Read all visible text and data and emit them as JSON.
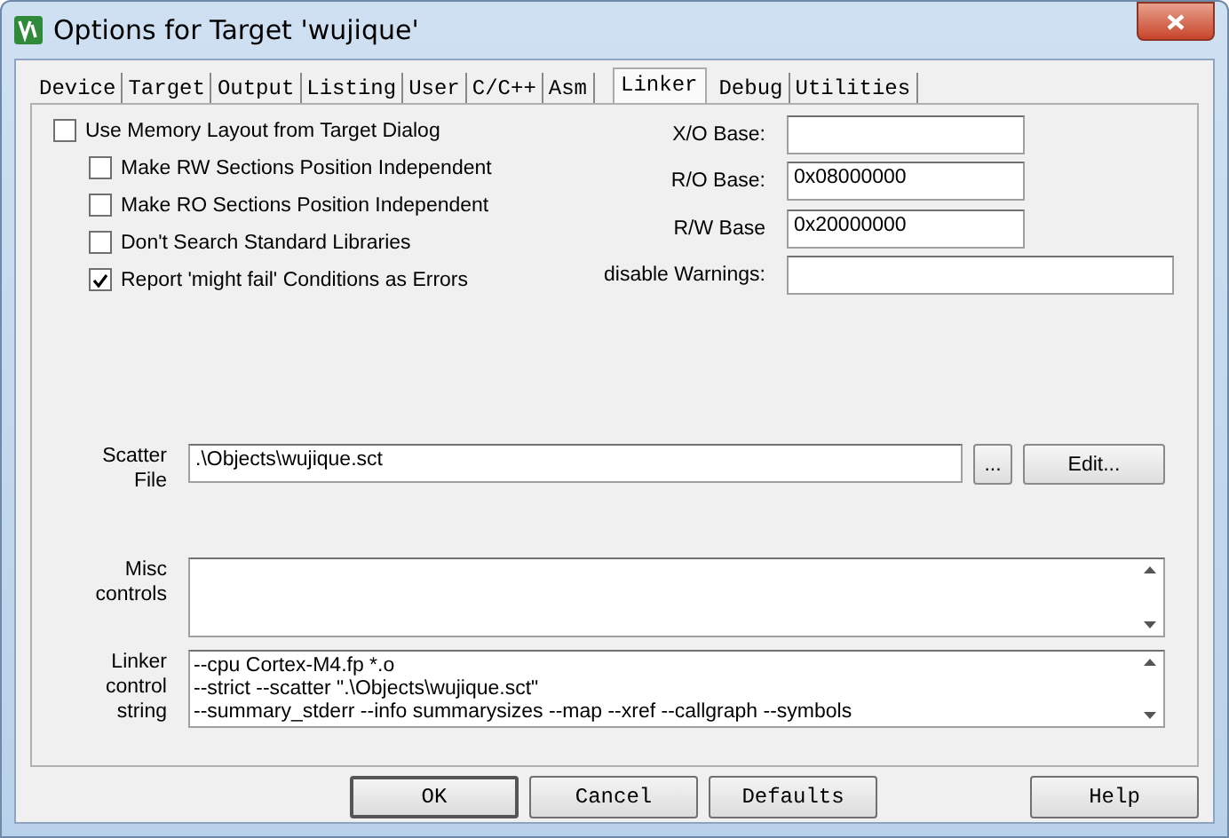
{
  "window": {
    "title": "Options for Target 'wujique'"
  },
  "tabs": [
    {
      "label": "Device",
      "selected": false
    },
    {
      "label": "Target",
      "selected": false
    },
    {
      "label": "Output",
      "selected": false
    },
    {
      "label": "Listing",
      "selected": false
    },
    {
      "label": "User",
      "selected": false
    },
    {
      "label": "C/C++",
      "selected": false
    },
    {
      "label": "Asm",
      "selected": false
    },
    {
      "label": "Linker",
      "selected": true
    },
    {
      "label": "Debug",
      "selected": false
    },
    {
      "label": "Utilities",
      "selected": false
    }
  ],
  "options": [
    {
      "kind": "main",
      "label": "Use Memory Layout from Target Dialog",
      "checked": false
    },
    {
      "kind": "sub",
      "label": "Make RW Sections Position Independent",
      "checked": false
    },
    {
      "kind": "sub",
      "label": "Make RO Sections Position Independent",
      "checked": false
    },
    {
      "kind": "sub",
      "label": "Don't Search Standard Libraries",
      "checked": false
    },
    {
      "kind": "sub",
      "label": "Report 'might fail' Conditions as Errors",
      "checked": true
    }
  ],
  "address_fields": [
    {
      "kind": "address",
      "label": "X/O Base:"
    },
    {
      "kind": "address",
      "label": "R/O Base:",
      "value": "0x08000000"
    },
    {
      "kind": "address",
      "label": "R/W Base",
      "value": "0x20000000"
    },
    {
      "kind": "text",
      "label": "disable Warnings:"
    }
  ],
  "scatter": {
    "label_lines": [
      "Scatter",
      "File"
    ],
    "value": ".\\Objects\\wujique.sct",
    "browse_button": "...",
    "edit_button": "Edit..."
  },
  "misc": {
    "label_lines": [
      "Misc",
      "controls"
    ]
  },
  "linker_string": {
    "label_lines": [
      "Linker",
      "control",
      "string"
    ],
    "lines": [
      "--cpu Cortex-M4.fp *.o",
      "--strict --scatter \".\\Objects\\wujique.sct\"",
      "--summary_stderr --info summarysizes --map --xref --callgraph --symbols"
    ]
  },
  "buttons": [
    "OK",
    "Cancel",
    "Defaults",
    "Help"
  ]
}
